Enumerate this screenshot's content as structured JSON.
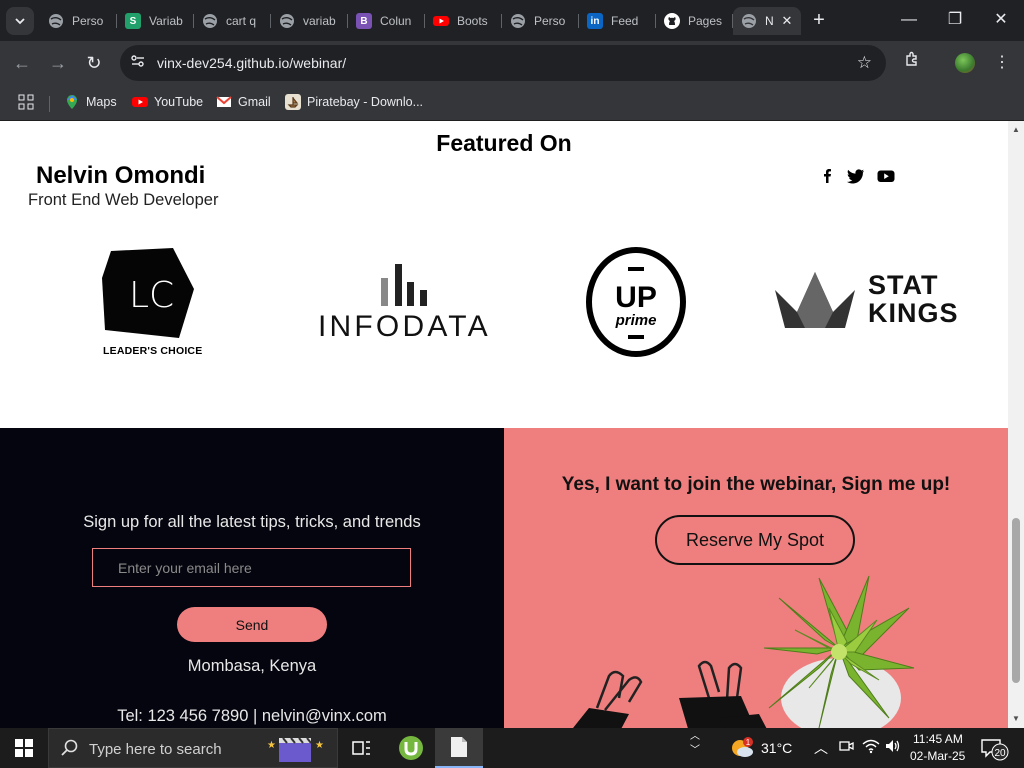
{
  "browser": {
    "tabs": [
      {
        "title": "Perso",
        "icon": "globe-icon",
        "color": "#9aa0a6"
      },
      {
        "title": "Variab",
        "icon": "s-icon",
        "color": "#22a06b"
      },
      {
        "title": "cart q",
        "icon": "globe-icon",
        "color": "#9aa0a6"
      },
      {
        "title": "variab",
        "icon": "globe-icon",
        "color": "#9aa0a6"
      },
      {
        "title": "Colun",
        "icon": "bootstrap-icon",
        "color": "#7952b3"
      },
      {
        "title": "Boots",
        "icon": "youtube-icon",
        "color": "#ff0000"
      },
      {
        "title": "Perso",
        "icon": "globe-icon",
        "color": "#9aa0a6"
      },
      {
        "title": "Feed",
        "icon": "linkedin-icon",
        "color": "#0a66c2"
      },
      {
        "title": "Pages",
        "icon": "github-icon",
        "color": "#ffffff"
      },
      {
        "title": "N",
        "icon": "globe-icon",
        "color": "#9aa0a6"
      }
    ],
    "url": "vinx-dev254.github.io/webinar/",
    "bookmarks": [
      {
        "label": "Maps"
      },
      {
        "label": "YouTube"
      },
      {
        "label": "Gmail"
      },
      {
        "label": "Piratebay - Downlo..."
      }
    ]
  },
  "page": {
    "featured_title": "Featured On",
    "name": "Nelvin Omondi",
    "role": "Front End Web Developer",
    "logos": {
      "lc_text": "LEADER'S CHOICE",
      "lc_mark": "LC",
      "infodata": "INFODATA",
      "up": "UP",
      "prime": "prime",
      "stat": "STAT",
      "kings": "KINGS"
    },
    "signup_text": "Sign up for all the latest tips, tricks, and trends",
    "email_placeholder": "Enter your email here",
    "send_label": "Send",
    "location": "Mombasa, Kenya",
    "contact": "Tel: 123 456 7890 | nelvin@vinx.com",
    "cta_heading": "Yes, I want to join the webinar, Sign me up!",
    "reserve_label": "Reserve My Spot",
    "colors": {
      "accent": "#ef7f7f",
      "dark": "#05050f"
    }
  },
  "taskbar": {
    "search_text": "Type here to search",
    "weather": "31°C",
    "weather_badge": "1",
    "time": "11:45 AM",
    "date": "02-Mar-25",
    "notifications": "20"
  }
}
